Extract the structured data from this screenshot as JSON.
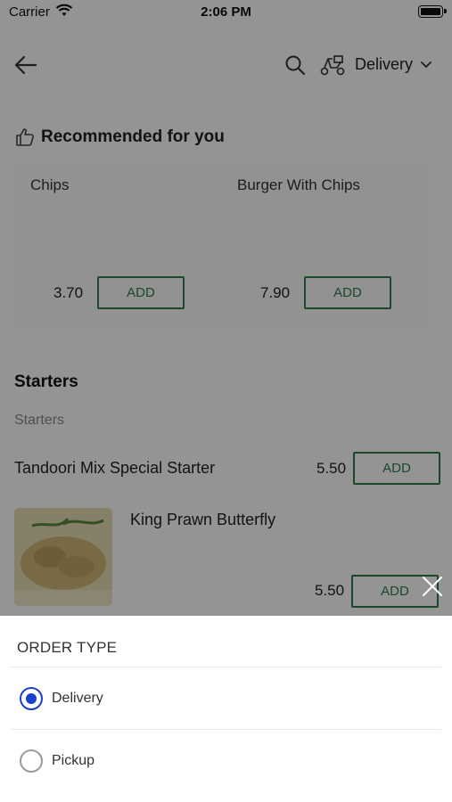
{
  "status_bar": {
    "carrier": "Carrier",
    "time": "2:06 PM"
  },
  "header": {
    "order_type": "Delivery",
    "icons": [
      "back-arrow-icon",
      "search-icon",
      "scooter-icon",
      "chevron-down-icon"
    ]
  },
  "recommended": {
    "title": "Recommended for you",
    "items": [
      {
        "name": "Chips",
        "price": "3.70",
        "add_label": "ADD"
      },
      {
        "name": "Burger With Chips",
        "price": "7.90",
        "add_label": "ADD"
      }
    ]
  },
  "menu": {
    "section_title": "Starters",
    "subsection_title": "Starters",
    "items": [
      {
        "name": "Tandoori Mix Special Starter",
        "price": "5.50",
        "add_label": "ADD"
      },
      {
        "name": "King Prawn Butterfly",
        "price": "5.50",
        "add_label": "ADD"
      }
    ]
  },
  "order_type_sheet": {
    "title": "ORDER TYPE",
    "options": [
      {
        "label": "Delivery",
        "selected": true
      },
      {
        "label": "Pickup",
        "selected": false
      }
    ]
  },
  "colors": {
    "accent_green": "#2e7d4a",
    "radio_blue": "#1b3fd0",
    "overlay": "rgba(0,0,0,0.42)"
  }
}
